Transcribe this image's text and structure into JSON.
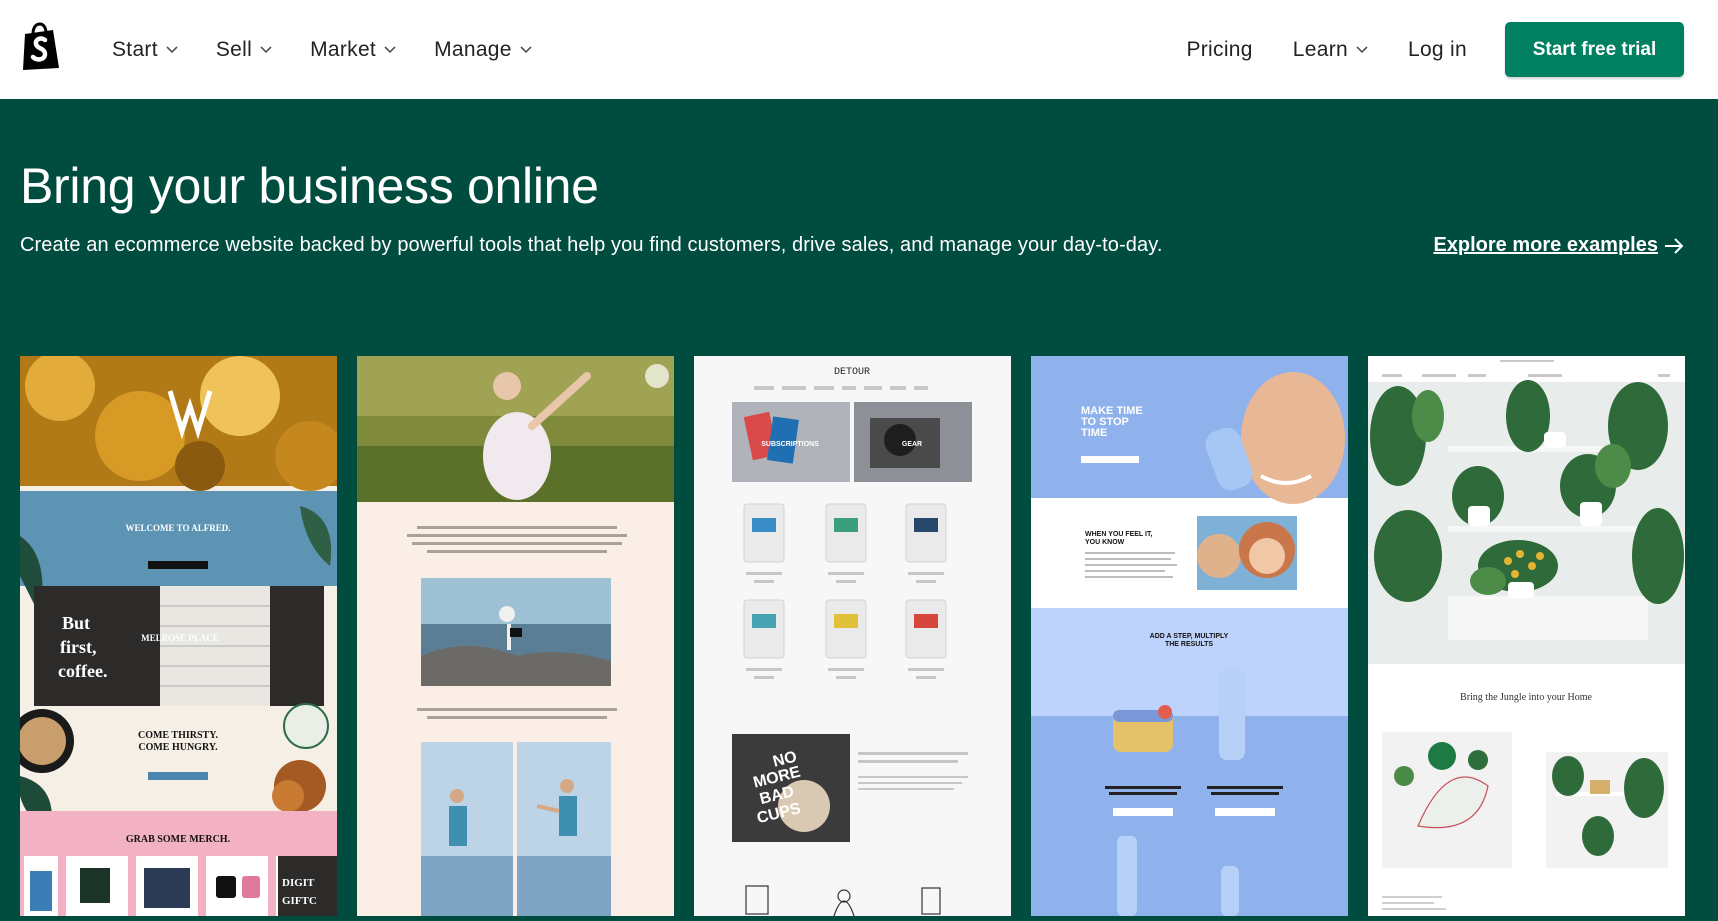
{
  "header": {
    "logo_icon": "shopify-bag-icon",
    "nav_left": [
      {
        "label": "Start"
      },
      {
        "label": "Sell"
      },
      {
        "label": "Market"
      },
      {
        "label": "Manage"
      }
    ],
    "nav_right": {
      "pricing": "Pricing",
      "learn": "Learn",
      "login": "Log in",
      "cta": "Start free trial"
    }
  },
  "hero": {
    "title": "Bring your business online",
    "subtitle": "Create an ecommerce website backed by powerful tools that help you find customers, drive sales, and manage your day-to-day.",
    "explore_link": "Explore more examples"
  },
  "examples": {
    "alfred": {
      "welcome": "WELCOME TO ALFRED.",
      "but_first_1": "But",
      "but_first_2": "first,",
      "but_first_3": "coffee.",
      "melrose": "MELROSE PLACE",
      "come_thirsty": "COME THIRSTY.",
      "come_hungry": "COME HUNGRY.",
      "merch": "GRAB SOME MERCH.",
      "digital": "DIGIT",
      "giftc": "GIFTC"
    },
    "detour": {
      "brand": "DETOUR",
      "subscriptions": "SUBSCRIPTIONS",
      "gear": "GEAR",
      "no_more_bad_cups": [
        "NO",
        "MORE",
        "BAD",
        "CUPS"
      ]
    },
    "beauty": {
      "make_time": [
        "MAKE TIME",
        "TO STOP",
        "TIME"
      ],
      "when_you_feel": [
        "WHEN YOU FEEL IT,",
        "YOU KNOW"
      ],
      "add_a_step": [
        "ADD A STEP, MULTIPLY",
        "THE RESULTS"
      ]
    },
    "jungle": {
      "tagline": "Bring the Jungle into your Home"
    }
  },
  "colors": {
    "brand_green": "#004c3f",
    "cta_green": "#008060",
    "header_bg": "#ffffff",
    "nav_text": "#212326"
  }
}
